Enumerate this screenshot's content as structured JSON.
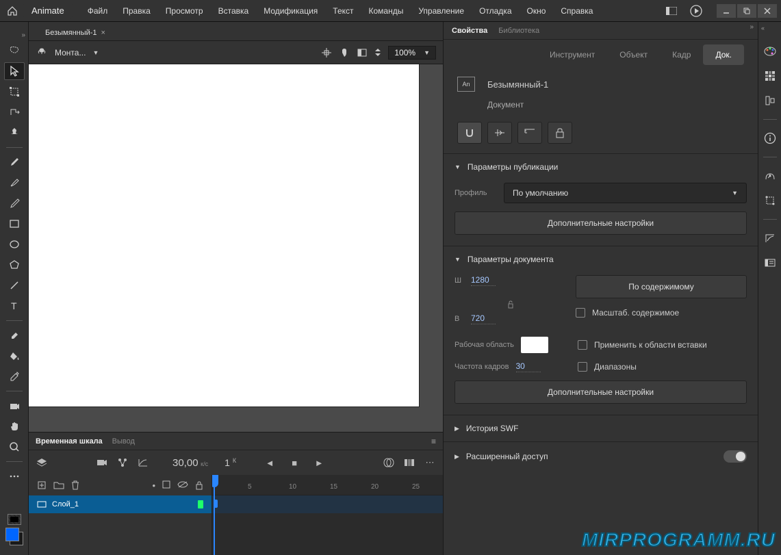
{
  "app": {
    "title": "Animate"
  },
  "menu": {
    "items": [
      "Файл",
      "Правка",
      "Просмотр",
      "Вставка",
      "Модификация",
      "Текст",
      "Команды",
      "Управление",
      "Отладка",
      "Окно",
      "Справка"
    ]
  },
  "docTabs": [
    {
      "name": "Безымянный-1"
    }
  ],
  "stage": {
    "sceneLabel": "Монта...",
    "zoom": "100%"
  },
  "timeline": {
    "tabs": {
      "active": "Временная шкала",
      "other": "Вывод"
    },
    "fpsValue": "30,00",
    "fpsUnit": "к/с",
    "frame": "1",
    "frameUnit": "К",
    "layerName": "Слой_1",
    "ruler": [
      "5",
      "10",
      "15",
      "20",
      "25"
    ]
  },
  "rightPanel": {
    "tabs": {
      "active": "Свойства",
      "other": "Библиотека"
    },
    "subtabs": {
      "tool": "Инструмент",
      "object": "Объект",
      "frame": "Кадр",
      "doc": "Док."
    },
    "docName": "Безымянный-1",
    "docType": "Документ",
    "sections": {
      "publish": {
        "title": "Параметры публикации",
        "profileLabel": "Профиль",
        "profileValue": "По умолчанию",
        "moreBtn": "Дополнительные настройки"
      },
      "docParams": {
        "title": "Параметры документа",
        "wLabel": "Ш",
        "wValue": "1280",
        "hLabel": "В",
        "hValue": "720",
        "fitBtn": "По содержимому",
        "scaleChk": "Масштаб. содержимое",
        "stageLabel": "Рабочая область",
        "applyChk": "Применить к области вставки",
        "fpsLabel": "Частота кадров",
        "fpsValue": "30",
        "rangesChk": "Диапазоны",
        "moreBtn": "Дополнительные настройки"
      },
      "swf": {
        "title": "История SWF"
      },
      "access": {
        "title": "Расширенный доступ"
      }
    }
  },
  "watermark": "MIRPROGRAMM.RU"
}
